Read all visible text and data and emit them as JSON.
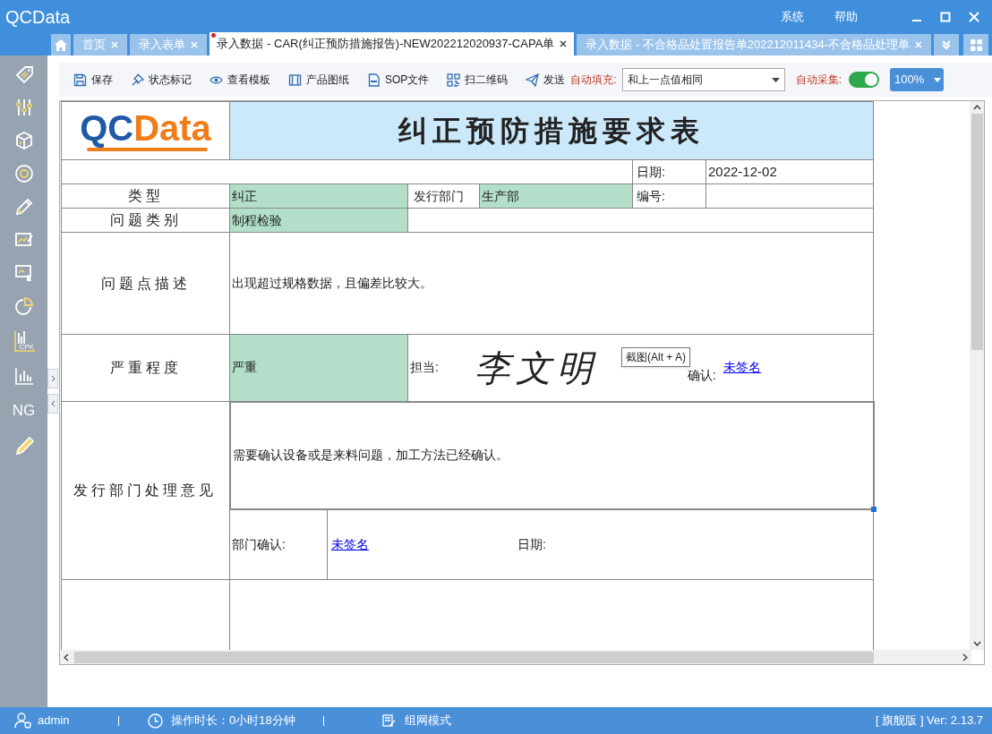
{
  "window": {
    "title": "QCData",
    "menu": [
      "系统",
      "帮助"
    ]
  },
  "tabs": [
    {
      "label": "首页",
      "selected": false,
      "unsaved": false
    },
    {
      "label": "录入表单",
      "selected": false,
      "unsaved": false
    },
    {
      "label": "录入数据 - CAR(纠正预防措施报告)-NEW202212020937-CAPA单",
      "selected": true,
      "unsaved": true
    },
    {
      "label": "录入数据 - 不合格品处置报告单202212011434-不合格品处理单",
      "selected": false,
      "unsaved": false
    }
  ],
  "sidebar": {
    "cpk_label": "CPK",
    "ng_label": "NG"
  },
  "toolbar": {
    "buttons": [
      "保存",
      "状态标记",
      "查看模板",
      "产品图纸",
      "SOP文件",
      "扫二维码",
      "发送"
    ],
    "auto_fill": {
      "label": "自动填充:",
      "value": "和上一点值相同"
    },
    "auto_capture": {
      "label": "自动采集:",
      "on": true
    },
    "zoom": "100%"
  },
  "form": {
    "logo": "QCData",
    "title": "纠正预防措施要求表",
    "date_label": "日期:",
    "date": "2022-12-02",
    "type_label": "类型",
    "type": "纠正",
    "issuer_label": "发行部门",
    "issuer": "生产部",
    "number_label": "编号:",
    "category_label": "问题类别",
    "category": "制程检验",
    "description_label": "问题点描述",
    "description": "出现超过规格数据，且偏差比较大。",
    "severity_label": "严重程度",
    "severity": "严重",
    "owner_label": "担当:",
    "owner_signature": "李文明",
    "confirm_label": "确认:",
    "confirm": "未签名",
    "opinion_label": "发行部门处理意见",
    "opinion": "需要确认设备或是来料问题，加工方法已经确认。",
    "dept_confirm_label": "部门确认:",
    "dept_confirm": "未签名",
    "dept_date_label": "日期:"
  },
  "tooltip": "截图(Alt + A)",
  "status_bar": {
    "user": "admin",
    "duration": "操作时长：0小时18分钟",
    "mode": "组网模式",
    "version": "[ 旗舰版 ] Ver: 2.13.7"
  }
}
